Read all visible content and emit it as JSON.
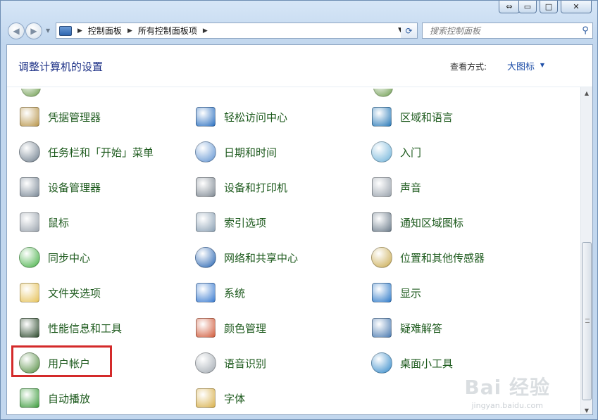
{
  "window": {
    "caption": {
      "swap": "⇔",
      "min": "▭",
      "max": "□",
      "close": "✕"
    }
  },
  "nav": {
    "back": "◀",
    "forward": "▶",
    "breadcrumbs": [
      "控制面板",
      "所有控制面板项"
    ],
    "search_placeholder": "搜索控制面板"
  },
  "header": {
    "title": "调整计算机的设置",
    "view_by_label": "查看方式:",
    "view_by_value": "大图标"
  },
  "items": [
    {
      "label": "凭据管理器",
      "icon": "credential-vault-icon",
      "color": "#b8954a"
    },
    {
      "label": "任务栏和「开始」菜单",
      "icon": "taskbar-icon",
      "color": "#6b7b8a"
    },
    {
      "label": "设备管理器",
      "icon": "device-manager-icon",
      "color": "#7a8896"
    },
    {
      "label": "鼠标",
      "icon": "mouse-icon",
      "color": "#9aa3ad"
    },
    {
      "label": "同步中心",
      "icon": "sync-center-icon",
      "color": "#3fae3f"
    },
    {
      "label": "文件夹选项",
      "icon": "folder-options-icon",
      "color": "#e6c25a"
    },
    {
      "label": "性能信息和工具",
      "icon": "performance-icon",
      "color": "#2d4a2d"
    },
    {
      "label": "用户帐户",
      "icon": "user-accounts-icon",
      "color": "#4f8a3c"
    },
    {
      "label": "自动播放",
      "icon": "autoplay-icon",
      "color": "#3a9b3a"
    },
    {
      "label": "轻松访问中心",
      "icon": "ease-of-access-icon",
      "color": "#2a6fc0"
    },
    {
      "label": "日期和时间",
      "icon": "date-time-icon",
      "color": "#5a8fd0"
    },
    {
      "label": "设备和打印机",
      "icon": "devices-printers-icon",
      "color": "#808a94"
    },
    {
      "label": "索引选项",
      "icon": "indexing-options-icon",
      "color": "#8aa0b4"
    },
    {
      "label": "网络和共享中心",
      "icon": "network-sharing-icon",
      "color": "#1f5fb0"
    },
    {
      "label": "系统",
      "icon": "system-icon",
      "color": "#3a7bd0"
    },
    {
      "label": "颜色管理",
      "icon": "color-management-icon",
      "color": "#d05a3a"
    },
    {
      "label": "语音识别",
      "icon": "speech-recognition-icon",
      "color": "#a0a8b0"
    },
    {
      "label": "字体",
      "icon": "fonts-icon",
      "color": "#d8b04a"
    },
    {
      "label": "区域和语言",
      "icon": "region-language-icon",
      "color": "#2a7ab8"
    },
    {
      "label": "入门",
      "icon": "getting-started-icon",
      "color": "#6ab0d8"
    },
    {
      "label": "声音",
      "icon": "sound-icon",
      "color": "#9aa3ad"
    },
    {
      "label": "通知区域图标",
      "icon": "notification-area-icon",
      "color": "#6b7b8a"
    },
    {
      "label": "位置和其他传感器",
      "icon": "location-sensors-icon",
      "color": "#c8a84a"
    },
    {
      "label": "显示",
      "icon": "display-icon",
      "color": "#2f7ac8"
    },
    {
      "label": "疑难解答",
      "icon": "troubleshooting-icon",
      "color": "#4a7ab0"
    },
    {
      "label": "桌面小工具",
      "icon": "desktop-gadgets-icon",
      "color": "#2d86c8"
    }
  ],
  "watermark": {
    "text": "Bai 经验",
    "sub": "jingyan.baidu.com"
  }
}
